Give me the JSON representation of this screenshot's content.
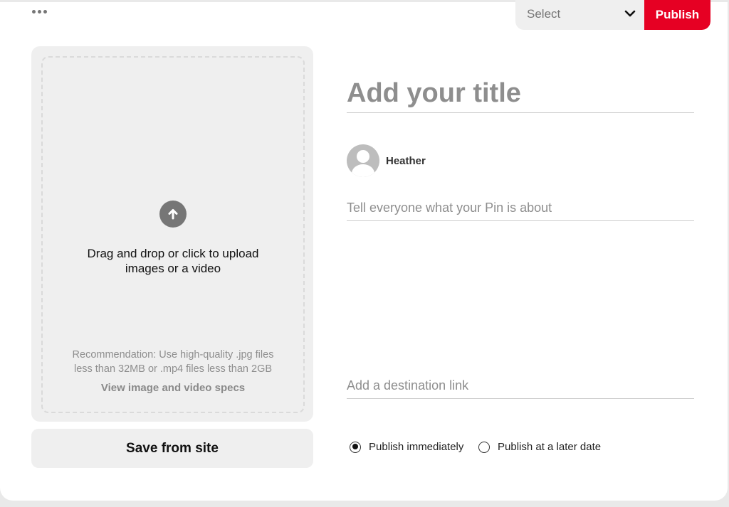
{
  "header": {
    "board_select": {
      "value": "Select",
      "icon": "chevron-down-icon"
    },
    "publish_label": "Publish",
    "publish_color": "#e60023"
  },
  "upload": {
    "icon": "arrow-up-icon",
    "main_text_line1": "Drag and drop or click to upload",
    "main_text_line2": "images or a video",
    "recommendation_line1": "Recommendation: Use high-quality .jpg files",
    "recommendation_line2": "less than 32MB or .mp4 files less than 2GB",
    "specs_link": "View image and video specs",
    "save_from_site_label": "Save from site"
  },
  "form": {
    "title_placeholder": "Add your title",
    "user_name": "Heather",
    "description_placeholder": "Tell everyone what your Pin is about",
    "link_placeholder": "Add a destination link",
    "publish_options": [
      {
        "label": "Publish immediately",
        "checked": true
      },
      {
        "label": "Publish at a later date",
        "checked": false
      }
    ]
  }
}
